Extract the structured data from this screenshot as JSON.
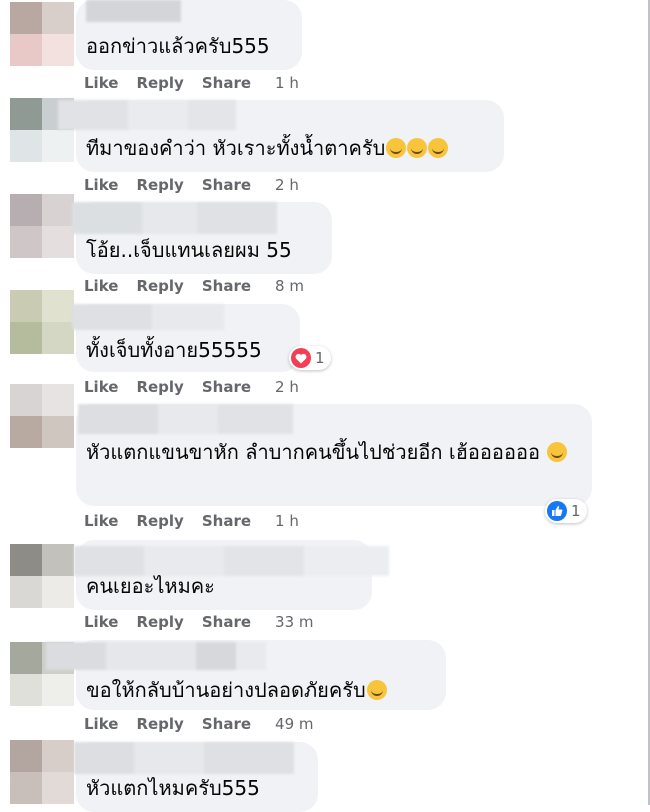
{
  "actions": {
    "like": "Like",
    "reply": "Reply",
    "share": "Share"
  },
  "comments": [
    {
      "text": "ออกข่าวแล้วครับ555",
      "time": "1 h"
    },
    {
      "text": "ทีมาของคำว่า หัวเราะทั้งน้ำตาครับ",
      "time": "2 h",
      "emoji_count": 3
    },
    {
      "text": "โอ้ย..เจ็บแทนเลยผม 55",
      "time": "8 m"
    },
    {
      "text": "ทั้งเจ็บทั้งอาย55555",
      "time": "2 h",
      "reaction": {
        "type": "love",
        "count": "1"
      }
    },
    {
      "text": "หัวแตกแขนขาหัก ลำบากคนขึ้นไปช่วยอีก เฮ้ออออออ",
      "time": "1 h",
      "reaction": {
        "type": "like",
        "count": "1"
      }
    },
    {
      "text": "คนเยอะไหมคะ",
      "time": "33 m"
    },
    {
      "text": "ขอให้กลับบ้านอย่างปลอดภัยครับ",
      "time": "49 m",
      "emoji_count": 1
    },
    {
      "text": "หัวแตกไหมครับ555",
      "time": ""
    }
  ],
  "colors": {
    "bubble": "#f0f2f5",
    "text": "#050505",
    "meta": "#65676b",
    "love": "#f33e58",
    "like": "#1877f2"
  }
}
